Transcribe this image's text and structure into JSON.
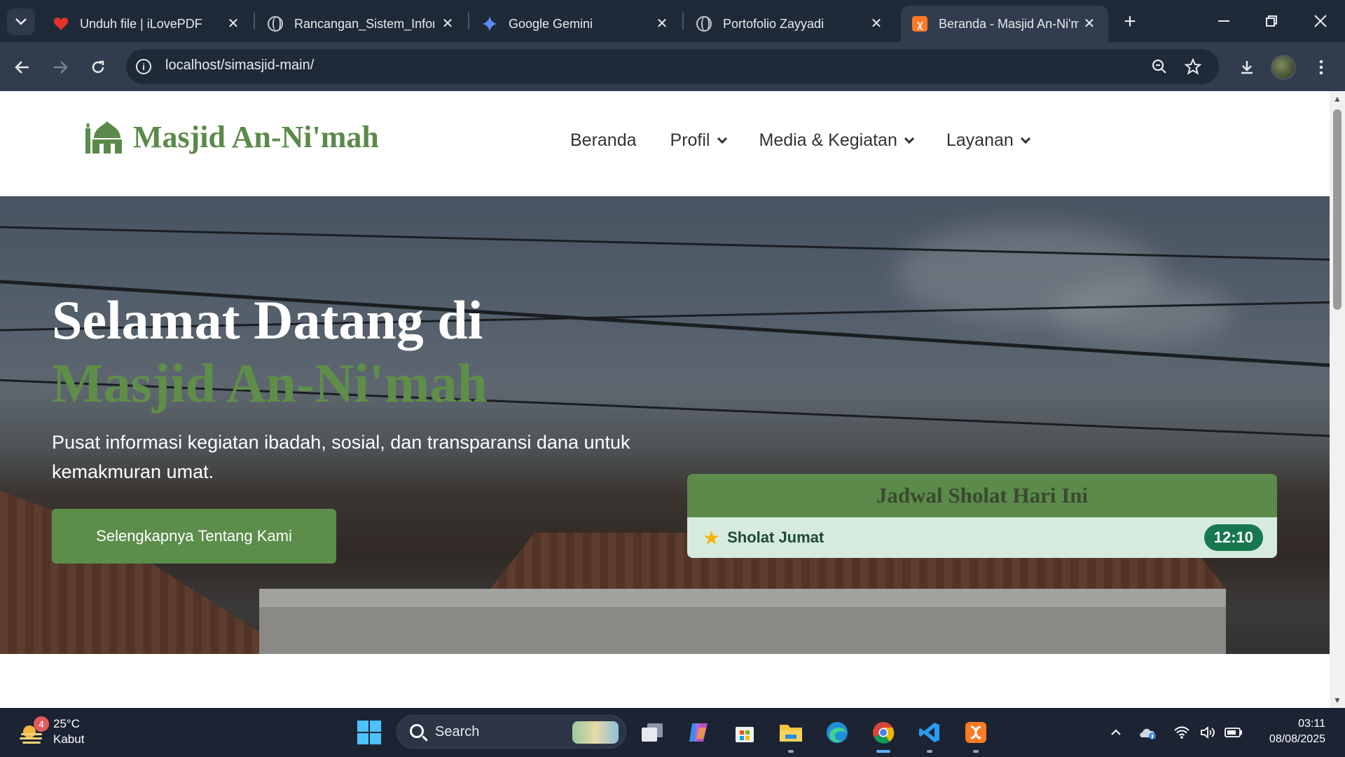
{
  "browser": {
    "tabs": [
      {
        "title": "Unduh file | iLovePDF",
        "favicon": "heart-icon"
      },
      {
        "title": "Rancangan_Sistem_Inform",
        "favicon": "globe-icon"
      },
      {
        "title": "Google Gemini",
        "favicon": "gemini-icon"
      },
      {
        "title": "Portofolio Zayyadi",
        "favicon": "globe-icon"
      },
      {
        "title": "Beranda - Masjid An-Ni'm",
        "favicon": "xampp-icon",
        "active": true
      }
    ],
    "url": "localhost/simasjid-main/"
  },
  "site": {
    "logo_text": "Masjid An-Ni'mah",
    "nav": {
      "beranda": "Beranda",
      "profil": "Profil",
      "media": "Media & Kegiatan",
      "layanan": "Layanan"
    },
    "hero": {
      "title_line1": "Selamat Datang di",
      "title_line2": "Masjid An-Ni'mah",
      "description": "Pusat informasi kegiatan ibadah, sosial, dan transparansi dana untuk kemakmuran umat.",
      "cta": "Selengkapnya Tentang Kami"
    },
    "prayer": {
      "heading": "Jadwal Sholat Hari Ini",
      "name": "Sholat Jumat",
      "time": "12:10"
    },
    "colors": {
      "brand_green": "#5c8d4b",
      "time_badge": "#17784f"
    }
  },
  "taskbar": {
    "weather_temp": "25°C",
    "weather_desc": "Kabut",
    "weather_badge": "4",
    "search_placeholder": "Search",
    "time": "03:11",
    "date": "08/08/2025"
  }
}
